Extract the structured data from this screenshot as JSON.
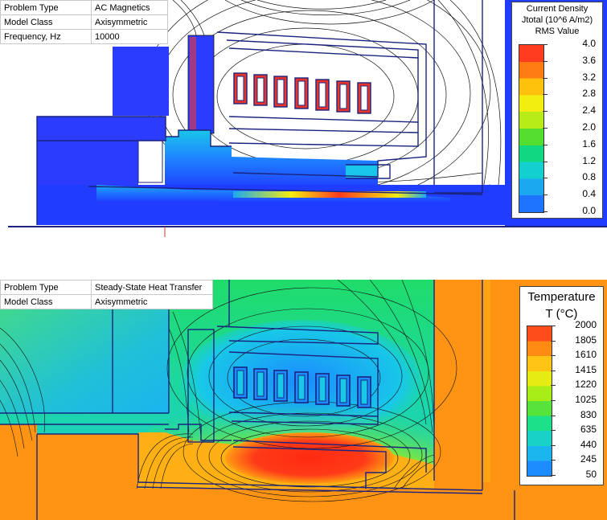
{
  "magnetics": {
    "info": [
      {
        "key": "Problem Type",
        "value": "AC Magnetics"
      },
      {
        "key": "Model Class",
        "value": "Axisymmetric"
      },
      {
        "key": "Frequency, Hz",
        "value": "10000"
      }
    ],
    "legend": {
      "line1": "Current Density",
      "line2": "Jtotal (10^6 A/m2)",
      "line3": "RMS Value",
      "values": [
        "4.0",
        "3.6",
        "3.2",
        "2.8",
        "2.4",
        "2.0",
        "1.6",
        "1.2",
        "0.8",
        "0.4",
        "0.0"
      ],
      "colors": [
        "#ff3b1f",
        "#ff7a12",
        "#ffc20c",
        "#f2ee10",
        "#b8ec18",
        "#55dd30",
        "#10d882",
        "#14cfd0",
        "#1ca8f0",
        "#1e74ff",
        "#1f3cff"
      ]
    }
  },
  "thermal": {
    "info": [
      {
        "key": "Problem Type",
        "value": "Steady-State Heat Transfer"
      },
      {
        "key": "Model Class",
        "value": "Axisymmetric"
      }
    ],
    "legend": {
      "line1": "Temperature",
      "line2": "T (°C)",
      "values": [
        "2000",
        "1805",
        "1610",
        "1415",
        "1220",
        "1025",
        "830",
        "635",
        "440",
        "245",
        "50"
      ],
      "colors": [
        "#ff4a1a",
        "#ff8a14",
        "#ffc414",
        "#e6ec12",
        "#a8ec18",
        "#58e33c",
        "#1ce08a",
        "#18d2c8",
        "#1ab4ee",
        "#1c8cff",
        "#1c64ff"
      ]
    }
  }
}
